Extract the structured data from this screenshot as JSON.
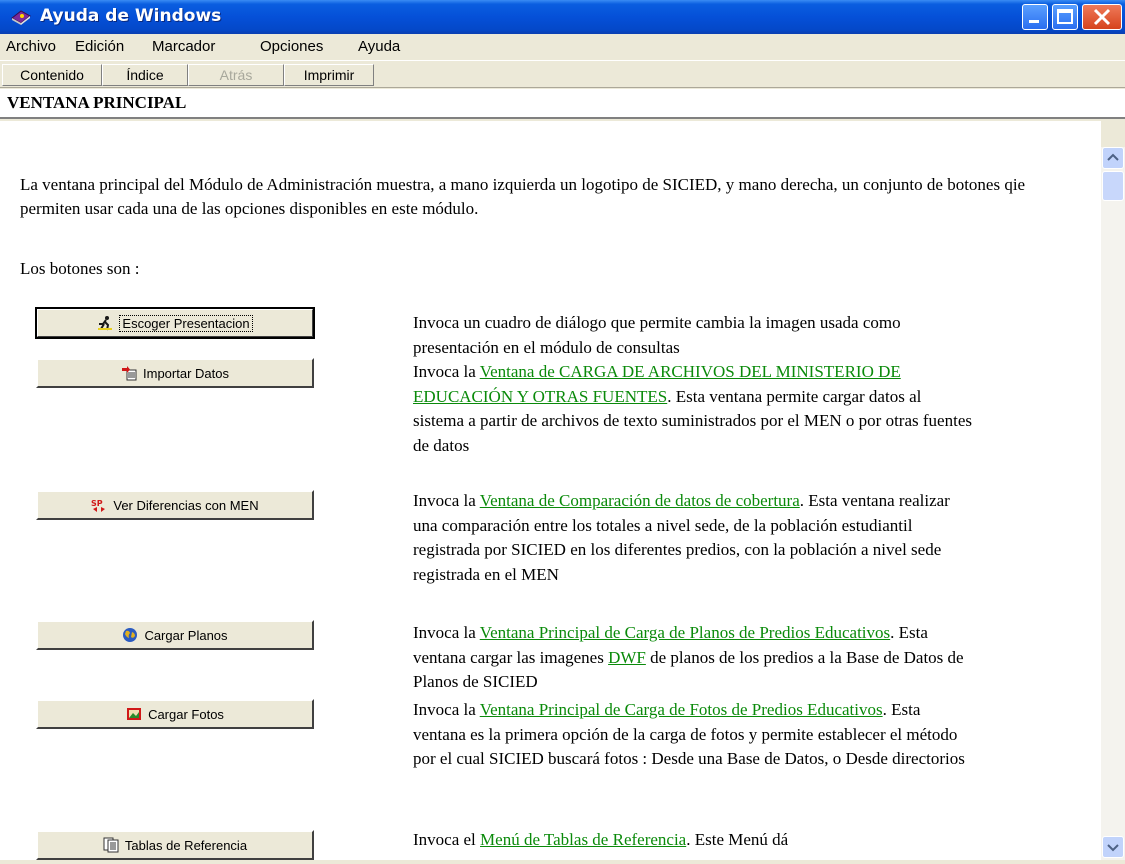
{
  "window": {
    "title": "Ayuda de Windows",
    "accent_color": "#0550d8"
  },
  "menu": [
    "Archivo",
    "Edición",
    "Marcador",
    "Opciones",
    "Ayuda"
  ],
  "toolbar": {
    "contents": "Contenido",
    "index": "Índice",
    "back": "Atrás",
    "print": "Imprimir"
  },
  "page": {
    "heading": "VENTANA PRINCIPAL",
    "intro": "La ventana principal del Módulo de Administración muestra, a mano izquierda un logotipo de SICIED, y mano derecha, un conjunto de botones qie permiten usar cada una de las opciones disponibles en este módulo.",
    "buttons_intro": "Los botones son :",
    "link_color": "#0a8a0a"
  },
  "buttons": [
    {
      "label": "Escoger Presentacion",
      "icon": "runner-icon"
    },
    {
      "label": "Importar Datos",
      "icon": "import-icon"
    },
    {
      "label": "Ver Diferencias con MEN",
      "icon": "compare-icon"
    },
    {
      "label": "Cargar Planos",
      "icon": "globe-icon"
    },
    {
      "label": "Cargar Fotos",
      "icon": "photo-icon"
    },
    {
      "label": "Tablas de Referencia",
      "icon": "tables-icon"
    }
  ],
  "descriptions": {
    "d0": {
      "text": "Invoca un cuadro de diálogo que permite cambia la imagen usada como presentación en el módulo de consultas"
    },
    "d1": {
      "pre": "Invoca la ",
      "link": "Ventana de CARGA DE ARCHIVOS DEL MINISTERIO DE EDUCACIÓN Y OTRAS FUENTES",
      "post": ". Esta ventana permite cargar datos al sistema a partir de archivos de texto suministrados por el MEN o por otras fuentes de datos"
    },
    "d2": {
      "pre": "Invoca la ",
      "link": "Ventana de Comparación de datos de cobertura",
      "post": ". Esta ventana realizar una comparación entre los totales a nivel sede, de la población estudiantil registrada por SICIED en los diferentes predios, con la población a nivel sede registrada en el MEN"
    },
    "d3": {
      "pre": "Invoca la ",
      "link": "Ventana Principal de Carga de Planos de Predios Educativos",
      "mid": ". Esta ventana cargar las imagenes ",
      "link2": "DWF",
      "post": " de planos de los predios a la Base de Datos de Planos de SICIED"
    },
    "d4": {
      "pre": "Invoca la ",
      "link": "Ventana Principal de Carga de Fotos de Predios Educativos",
      "post": ". Esta ventana es la primera opción de la carga de fotos y permite establecer el método por el cual SICIED buscará fotos : Desde una Base de Datos, o Desde directorios"
    },
    "d5": {
      "pre": "Invoca el ",
      "link": "Menú de Tablas de Referencia",
      "post": ". Este Menú dá"
    }
  }
}
